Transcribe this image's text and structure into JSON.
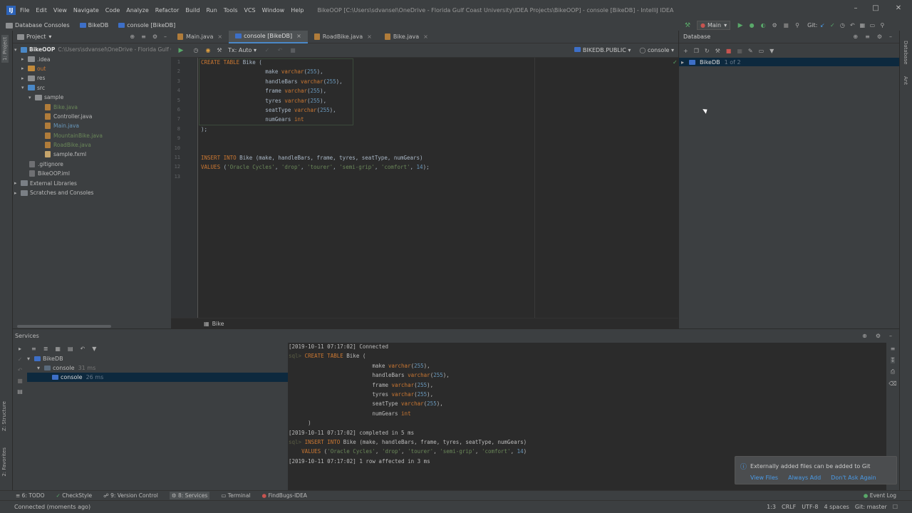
{
  "menubar": {
    "items": [
      "File",
      "Edit",
      "View",
      "Navigate",
      "Code",
      "Analyze",
      "Refactor",
      "Build",
      "Run",
      "Tools",
      "VCS",
      "Window",
      "Help"
    ],
    "window_title": "BikeOOP [C:\\Users\\sdvansel\\OneDrive - Florida Gulf Coast University\\IDEA Projects\\BikeOOP] - console [BikeDB] - IntelliJ IDEA",
    "run_config": "Main",
    "git_label": "Git:"
  },
  "navbar": {
    "crumbs": [
      "Database Consoles",
      "BikeDB",
      "console [BikeDB]"
    ]
  },
  "project": {
    "header": "Project",
    "root": "BikeOOP",
    "root_path": "C:\\Users\\sdvansel\\OneDrive - Florida Gulf Co",
    "items": [
      ".idea",
      "out",
      "res",
      "src",
      "sample",
      "Bike.java",
      "Controller.java",
      "Main.java",
      "MountainBike.java",
      "RoadBike.java",
      "sample.fxml",
      ".gitignore",
      "BikeOOP.iml",
      "External Libraries",
      "Scratches and Consoles"
    ]
  },
  "editor": {
    "tabs": [
      "Main.java",
      "console [BikeDB]",
      "RoadBike.java",
      "Bike.java"
    ],
    "tx": "Tx: Auto",
    "schema": "BIKEDB.PUBLIC",
    "console": "console",
    "line_numbers": [
      "1",
      "2",
      "3",
      "4",
      "5",
      "6",
      "7",
      "8",
      "9",
      "10",
      "11",
      "12",
      "13"
    ],
    "breadcrumb": "Bike"
  },
  "database": {
    "header": "Database",
    "db_name": "BikeDB",
    "db_count": "1 of 2"
  },
  "left_strip": {
    "tabs": [
      "1: Project",
      "Z: Structure",
      "2: Favorites"
    ]
  },
  "right_strip": {
    "tabs": [
      "Database",
      "Ant"
    ]
  },
  "services": {
    "header": "Services",
    "tree": {
      "db": "BikeDB",
      "console_group": "console",
      "console_group_time": "31 ms",
      "console_item": "console",
      "console_item_time": "26 ms"
    },
    "output": {
      "connected": "[2019-10-11 07:17:02] Connected",
      "completed": "[2019-10-11 07:17:02] completed in 5 ms",
      "affected": "[2019-10-11 07:17:02] 1 row affected in 3 ms"
    }
  },
  "notification": {
    "message": "Externally added files can be added to Git",
    "actions": [
      "View Files",
      "Always Add",
      "Don't Ask Again"
    ]
  },
  "tooltabs": [
    "6: TODO",
    "CheckStyle",
    "9: Version Control",
    "8: Services",
    "Terminal",
    "FindBugs-IDEA"
  ],
  "event_log": "Event Log",
  "status": {
    "message": "Connected (moments ago)",
    "position": "1:3",
    "line_sep": "CRLF",
    "encoding": "UTF-8",
    "indent": "4 spaces",
    "branch": "Git: master"
  }
}
